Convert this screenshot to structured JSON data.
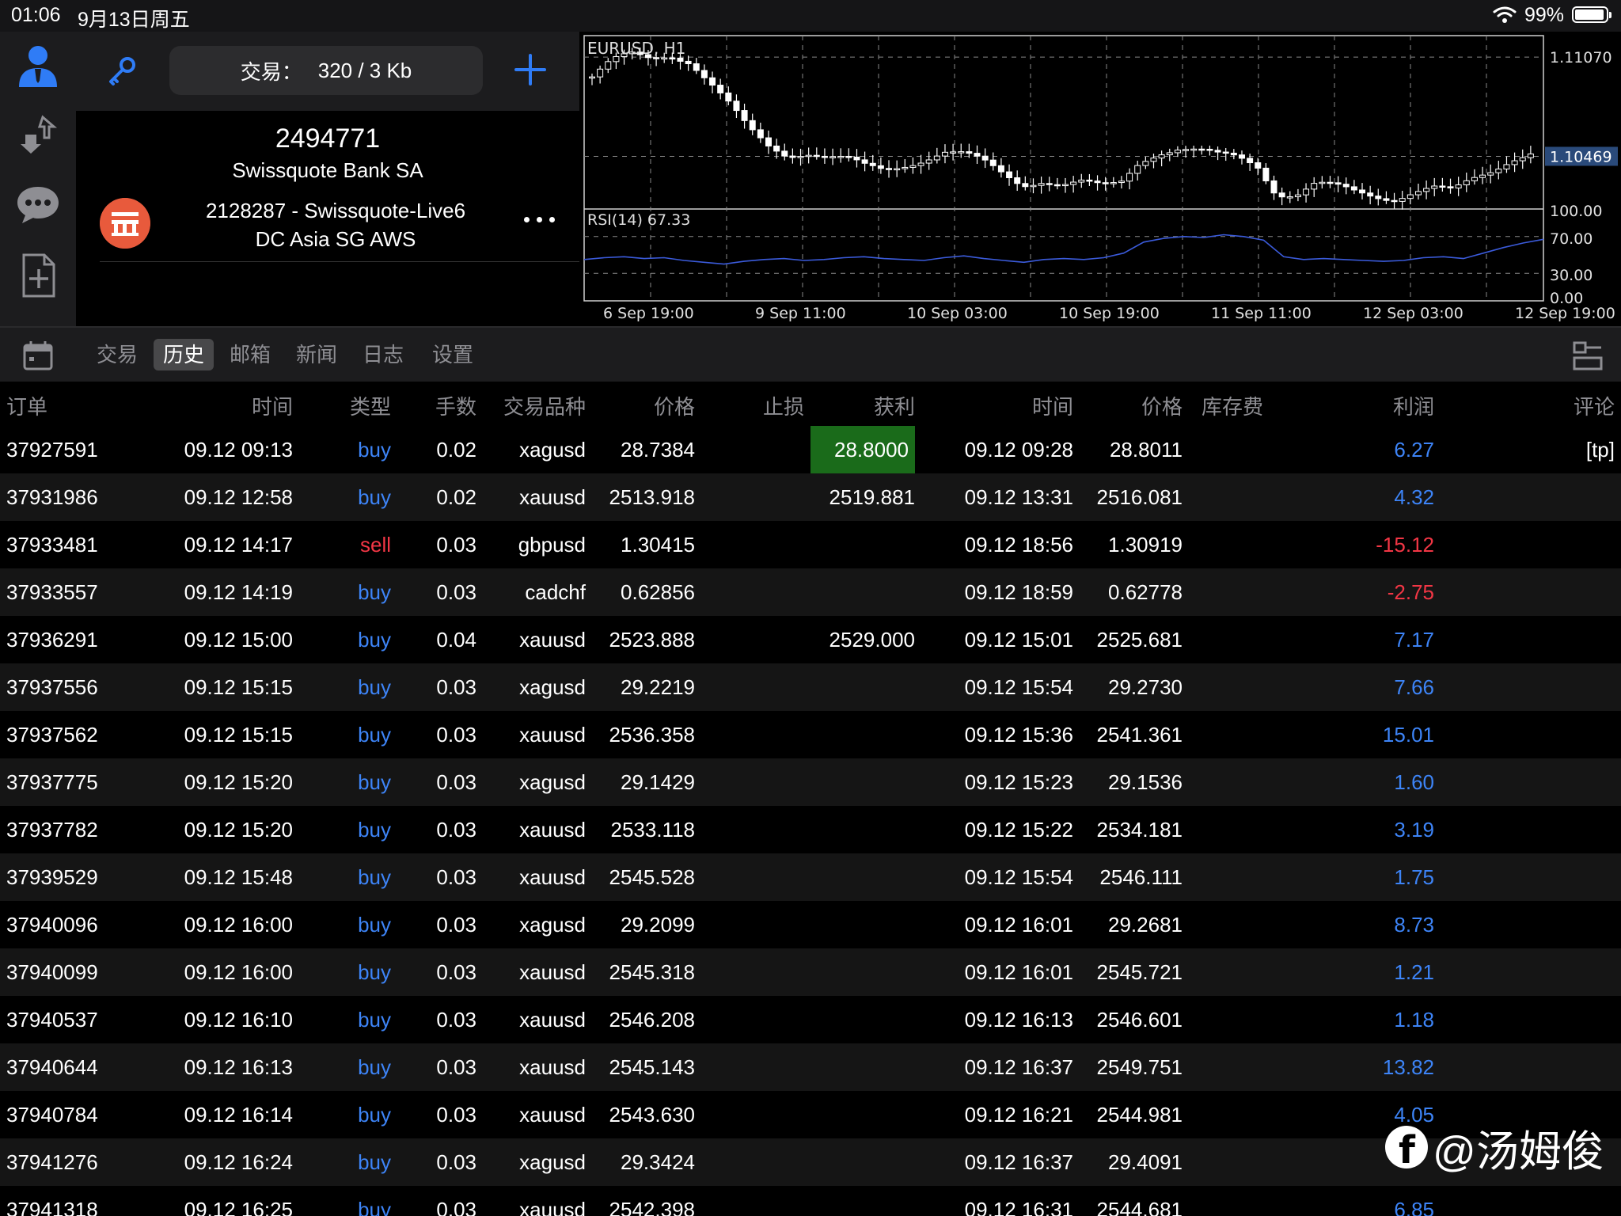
{
  "status": {
    "time": "01:06",
    "date": "9月13日周五",
    "battery": "99%"
  },
  "account": {
    "traffic_label": "交易：",
    "traffic_value": "320 / 3 Kb",
    "number": "2494771",
    "broker": "Swissquote Bank SA",
    "server_line1": "2128287 - Swissquote-Live6",
    "server_line2": "DC Asia SG AWS"
  },
  "icons": {
    "rail": [
      "account-icon",
      "transfer-icon",
      "chat-icon",
      "add-document-icon"
    ],
    "toolbar": [
      "key-icon",
      "add-icon",
      "more-icon"
    ],
    "tab_bar": [
      "calendar-icon",
      "layout-icon"
    ]
  },
  "chart_data": {
    "type": "candlestick",
    "title": "EURUSD, H1",
    "price_labels": [
      "1.11070",
      "1.10469"
    ],
    "current_price": "1.10469",
    "x_labels": [
      "6 Sep 19:00",
      "9 Sep 11:00",
      "10 Sep 03:00",
      "10 Sep 19:00",
      "11 Sep 11:00",
      "12 Sep 03:00",
      "12 Sep 19:00"
    ],
    "close_trend": [
      1.1095,
      1.1104,
      1.1108,
      1.1106,
      1.1109,
      1.1105,
      1.1092,
      1.1078,
      1.1063,
      1.1053,
      1.1048,
      1.105,
      1.1047,
      1.1045,
      1.104,
      1.1038,
      1.1042,
      1.1046,
      1.105,
      1.1048,
      1.1043,
      1.1036,
      1.103,
      1.1033,
      1.103,
      1.1031,
      1.1028,
      1.103,
      1.1044,
      1.105,
      1.1052,
      1.105,
      1.1047,
      1.1046,
      1.1042,
      1.1025,
      1.1024,
      1.103,
      1.1028,
      1.1025,
      1.1023,
      1.1022,
      1.1026,
      1.1028,
      1.1025,
      1.1032,
      1.1038,
      1.1046,
      1.105
    ],
    "indicator": {
      "label": "RSI(14) 67.33",
      "levels": [
        "100.00",
        "70.00",
        "30.00",
        "0.00"
      ],
      "values": [
        45,
        47,
        48,
        46,
        47,
        44,
        42,
        40,
        43,
        45,
        46,
        44,
        45,
        47,
        48,
        46,
        45,
        44,
        47,
        49,
        46,
        44,
        42,
        45,
        46,
        45,
        47,
        52,
        64,
        68,
        70,
        69,
        72,
        70,
        66,
        48,
        45,
        46,
        45,
        44,
        43,
        44,
        47,
        48,
        46,
        52,
        58,
        63,
        67
      ]
    }
  },
  "tabs": [
    "交易",
    "历史",
    "邮箱",
    "新闻",
    "日志",
    "设置"
  ],
  "active_tab": 1,
  "table": {
    "headers": [
      "订单",
      "时间",
      "类型",
      "手数",
      "交易品种",
      "价格",
      "止损",
      "获利",
      "时间",
      "价格",
      "库存费",
      "利润",
      "评论"
    ],
    "rows": [
      {
        "order": "37927591",
        "open_time": "09.12 09:13",
        "type": "buy",
        "volume": "0.02",
        "symbol": "xagusd",
        "open_price": "28.7384",
        "sl": "",
        "tp": "28.8000",
        "close_time": "09.12 09:28",
        "close_price": "28.8011",
        "swap": "",
        "profit": "6.27",
        "comment": "[tp]",
        "tp_hit": true
      },
      {
        "order": "37931986",
        "open_time": "09.12 12:58",
        "type": "buy",
        "volume": "0.02",
        "symbol": "xauusd",
        "open_price": "2513.918",
        "sl": "",
        "tp": "2519.881",
        "close_time": "09.12 13:31",
        "close_price": "2516.081",
        "swap": "",
        "profit": "4.32",
        "comment": ""
      },
      {
        "order": "37933481",
        "open_time": "09.12 14:17",
        "type": "sell",
        "volume": "0.03",
        "symbol": "gbpusd",
        "open_price": "1.30415",
        "sl": "",
        "tp": "",
        "close_time": "09.12 18:56",
        "close_price": "1.30919",
        "swap": "",
        "profit": "-15.12",
        "comment": ""
      },
      {
        "order": "37933557",
        "open_time": "09.12 14:19",
        "type": "buy",
        "volume": "0.03",
        "symbol": "cadchf",
        "open_price": "0.62856",
        "sl": "",
        "tp": "",
        "close_time": "09.12 18:59",
        "close_price": "0.62778",
        "swap": "",
        "profit": "-2.75",
        "comment": ""
      },
      {
        "order": "37936291",
        "open_time": "09.12 15:00",
        "type": "buy",
        "volume": "0.04",
        "symbol": "xauusd",
        "open_price": "2523.888",
        "sl": "",
        "tp": "2529.000",
        "close_time": "09.12 15:01",
        "close_price": "2525.681",
        "swap": "",
        "profit": "7.17",
        "comment": ""
      },
      {
        "order": "37937556",
        "open_time": "09.12 15:15",
        "type": "buy",
        "volume": "0.03",
        "symbol": "xagusd",
        "open_price": "29.2219",
        "sl": "",
        "tp": "",
        "close_time": "09.12 15:54",
        "close_price": "29.2730",
        "swap": "",
        "profit": "7.66",
        "comment": ""
      },
      {
        "order": "37937562",
        "open_time": "09.12 15:15",
        "type": "buy",
        "volume": "0.03",
        "symbol": "xauusd",
        "open_price": "2536.358",
        "sl": "",
        "tp": "",
        "close_time": "09.12 15:36",
        "close_price": "2541.361",
        "swap": "",
        "profit": "15.01",
        "comment": ""
      },
      {
        "order": "37937775",
        "open_time": "09.12 15:20",
        "type": "buy",
        "volume": "0.03",
        "symbol": "xagusd",
        "open_price": "29.1429",
        "sl": "",
        "tp": "",
        "close_time": "09.12 15:23",
        "close_price": "29.1536",
        "swap": "",
        "profit": "1.60",
        "comment": ""
      },
      {
        "order": "37937782",
        "open_time": "09.12 15:20",
        "type": "buy",
        "volume": "0.03",
        "symbol": "xauusd",
        "open_price": "2533.118",
        "sl": "",
        "tp": "",
        "close_time": "09.12 15:22",
        "close_price": "2534.181",
        "swap": "",
        "profit": "3.19",
        "comment": ""
      },
      {
        "order": "37939529",
        "open_time": "09.12 15:48",
        "type": "buy",
        "volume": "0.03",
        "symbol": "xauusd",
        "open_price": "2545.528",
        "sl": "",
        "tp": "",
        "close_time": "09.12 15:54",
        "close_price": "2546.111",
        "swap": "",
        "profit": "1.75",
        "comment": ""
      },
      {
        "order": "37940096",
        "open_time": "09.12 16:00",
        "type": "buy",
        "volume": "0.03",
        "symbol": "xagusd",
        "open_price": "29.2099",
        "sl": "",
        "tp": "",
        "close_time": "09.12 16:01",
        "close_price": "29.2681",
        "swap": "",
        "profit": "8.73",
        "comment": ""
      },
      {
        "order": "37940099",
        "open_time": "09.12 16:00",
        "type": "buy",
        "volume": "0.03",
        "symbol": "xauusd",
        "open_price": "2545.318",
        "sl": "",
        "tp": "",
        "close_time": "09.12 16:01",
        "close_price": "2545.721",
        "swap": "",
        "profit": "1.21",
        "comment": ""
      },
      {
        "order": "37940537",
        "open_time": "09.12 16:10",
        "type": "buy",
        "volume": "0.03",
        "symbol": "xauusd",
        "open_price": "2546.208",
        "sl": "",
        "tp": "",
        "close_time": "09.12 16:13",
        "close_price": "2546.601",
        "swap": "",
        "profit": "1.18",
        "comment": ""
      },
      {
        "order": "37940644",
        "open_time": "09.12 16:13",
        "type": "buy",
        "volume": "0.03",
        "symbol": "xauusd",
        "open_price": "2545.143",
        "sl": "",
        "tp": "",
        "close_time": "09.12 16:37",
        "close_price": "2549.751",
        "swap": "",
        "profit": "13.82",
        "comment": ""
      },
      {
        "order": "37940784",
        "open_time": "09.12 16:14",
        "type": "buy",
        "volume": "0.03",
        "symbol": "xauusd",
        "open_price": "2543.630",
        "sl": "",
        "tp": "",
        "close_time": "09.12 16:21",
        "close_price": "2544.981",
        "swap": "",
        "profit": "4.05",
        "comment": ""
      },
      {
        "order": "37941276",
        "open_time": "09.12 16:24",
        "type": "buy",
        "volume": "0.03",
        "symbol": "xagusd",
        "open_price": "29.3424",
        "sl": "",
        "tp": "",
        "close_time": "09.12 16:37",
        "close_price": "29.4091",
        "swap": "",
        "profit": "",
        "comment": ""
      },
      {
        "order": "37941318",
        "open_time": "09.12 16:25",
        "type": "buy",
        "volume": "0.03",
        "symbol": "xauusd",
        "open_price": "2542.398",
        "sl": "",
        "tp": "",
        "close_time": "09.12 16:31",
        "close_price": "2544.681",
        "swap": "",
        "profit": "6.85",
        "comment": ""
      }
    ]
  },
  "watermark": "@汤姆俊"
}
